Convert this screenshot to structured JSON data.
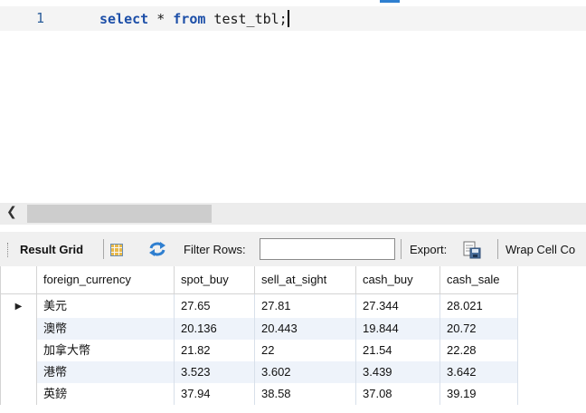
{
  "editor": {
    "line_number": "1",
    "code": {
      "kw_select": "select",
      "star": " * ",
      "kw_from": "from",
      "rest": " test_tbl;"
    }
  },
  "toolbar": {
    "result_tab": "Result Grid",
    "filter_label": "Filter Rows:",
    "filter_value": "",
    "export_label": "Export:",
    "wrap_label": "Wrap Cell Co"
  },
  "grid": {
    "columns": [
      "foreign_currency",
      "spot_buy",
      "sell_at_sight",
      "cash_buy",
      "cash_sale"
    ],
    "rows": [
      [
        "美元",
        "27.65",
        "27.81",
        "27.344",
        "28.021"
      ],
      [
        "澳幣",
        "20.136",
        "20.443",
        "19.844",
        "20.72"
      ],
      [
        "加拿大幣",
        "21.82",
        "22",
        "21.54",
        "22.28"
      ],
      [
        "港幣",
        "3.523",
        "3.602",
        "3.439",
        "3.642"
      ],
      [
        "英鎊",
        "37.94",
        "38.58",
        "37.08",
        "39.19"
      ]
    ]
  },
  "icons": {
    "scroll_left": "scroll-left-arrow-icon",
    "grid_view": "grid-view-icon",
    "refresh": "refresh-icon",
    "export": "export-icon",
    "row_pointer": "row-pointer-icon"
  },
  "colors": {
    "keyword": "#1d4fa8",
    "line_number": "#2b5d9a",
    "row_alt": "#eef3fa"
  }
}
